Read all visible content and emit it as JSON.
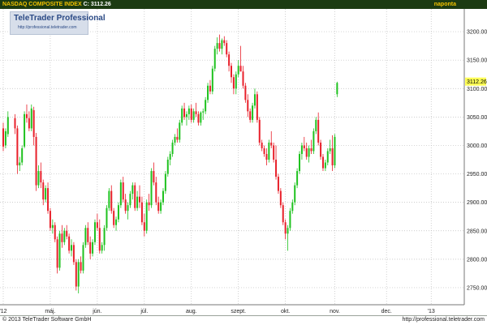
{
  "header": {
    "title": "NASDAQ COMPOSITE INDEX",
    "close_label": "C: 3112.26",
    "period": "naponta"
  },
  "watermark": {
    "title": "TeleTrader Professional",
    "url": "http://professional.teletrader.com"
  },
  "footer": {
    "copyright": "© 2013 TeleTrader Software GmbH",
    "url": "http://professional.teletrader.com"
  },
  "colors": {
    "plot_bg": "#ffffff",
    "grid": "#bdbdbd",
    "up": "#1fc21f",
    "down": "#e8202a",
    "header_bg": "#1c3b12",
    "header_text": "#f2c200",
    "last_price_bg": "#ffff55"
  },
  "chart_data": {
    "type": "candlestick",
    "title": "NASDAQ COMPOSITE INDEX",
    "last_price": "3112.26",
    "ylim": [
      2720,
      3240
    ],
    "y_ticks": [
      "2750.00",
      "2800.00",
      "2850.00",
      "2900.00",
      "2950.00",
      "3000.00",
      "3050.00",
      "3100.00",
      "3150.00",
      "3200.00"
    ],
    "x_ticks": [
      {
        "label": "'12",
        "index": 0
      },
      {
        "label": "máj.",
        "index": 20
      },
      {
        "label": "jún.",
        "index": 40
      },
      {
        "label": "júl.",
        "index": 60
      },
      {
        "label": "aug.",
        "index": 80
      },
      {
        "label": "szept.",
        "index": 100
      },
      {
        "label": "okt.",
        "index": 120
      },
      {
        "label": "nov.",
        "index": 141
      },
      {
        "label": "dec.",
        "index": 163
      },
      {
        "label": "'13",
        "index": 182
      }
    ],
    "grid": "dotted",
    "candles": [
      [
        3030,
        3040,
        2990,
        2998
      ],
      [
        3000,
        3030,
        2995,
        3025
      ],
      [
        3020,
        3060,
        3015,
        3050
      ],
      [
        3048,
        3055,
        3020,
        3030
      ],
      [
        3030,
        3035,
        2950,
        2965
      ],
      [
        2965,
        2980,
        2955,
        2970
      ],
      [
        2970,
        3000,
        2965,
        2995
      ],
      [
        2998,
        3060,
        2995,
        3055
      ],
      [
        3055,
        3072,
        3040,
        3048
      ],
      [
        3048,
        3060,
        3025,
        3030
      ],
      [
        3030,
        3072,
        3025,
        3065
      ],
      [
        3062,
        3068,
        3000,
        3015
      ],
      [
        3015,
        3022,
        2920,
        2930
      ],
      [
        2930,
        2965,
        2925,
        2955
      ],
      [
        2955,
        2970,
        2925,
        2935
      ],
      [
        2935,
        2940,
        2895,
        2905
      ],
      [
        2905,
        2930,
        2900,
        2925
      ],
      [
        2925,
        2935,
        2880,
        2885
      ],
      [
        2885,
        2890,
        2850,
        2855
      ],
      [
        2855,
        2870,
        2845,
        2860
      ],
      [
        2860,
        2865,
        2830,
        2835
      ],
      [
        2835,
        2840,
        2775,
        2785
      ],
      [
        2785,
        2850,
        2780,
        2845
      ],
      [
        2845,
        2860,
        2820,
        2830
      ],
      [
        2830,
        2855,
        2825,
        2850
      ],
      [
        2850,
        2860,
        2835,
        2840
      ],
      [
        2840,
        2845,
        2810,
        2815
      ],
      [
        2815,
        2835,
        2805,
        2825
      ],
      [
        2825,
        2830,
        2790,
        2795
      ],
      [
        2795,
        2800,
        2745,
        2752
      ],
      [
        2752,
        2800,
        2740,
        2795
      ],
      [
        2795,
        2805,
        2775,
        2780
      ],
      [
        2780,
        2830,
        2775,
        2825
      ],
      [
        2825,
        2860,
        2820,
        2855
      ],
      [
        2855,
        2865,
        2825,
        2830
      ],
      [
        2830,
        2840,
        2800,
        2810
      ],
      [
        2810,
        2835,
        2805,
        2830
      ],
      [
        2830,
        2870,
        2825,
        2865
      ],
      [
        2865,
        2880,
        2850,
        2855
      ],
      [
        2855,
        2870,
        2810,
        2815
      ],
      [
        2815,
        2830,
        2810,
        2825
      ],
      [
        2825,
        2860,
        2815,
        2855
      ],
      [
        2855,
        2895,
        2850,
        2890
      ],
      [
        2890,
        2925,
        2885,
        2920
      ],
      [
        2920,
        2930,
        2880,
        2885
      ],
      [
        2885,
        2890,
        2855,
        2860
      ],
      [
        2860,
        2875,
        2850,
        2870
      ],
      [
        2870,
        2900,
        2865,
        2895
      ],
      [
        2895,
        2940,
        2890,
        2935
      ],
      [
        2935,
        2945,
        2900,
        2905
      ],
      [
        2905,
        2915,
        2880,
        2885
      ],
      [
        2885,
        2900,
        2870,
        2895
      ],
      [
        2895,
        2920,
        2890,
        2915
      ],
      [
        2915,
        2935,
        2905,
        2930
      ],
      [
        2930,
        2935,
        2885,
        2890
      ],
      [
        2890,
        2920,
        2885,
        2910
      ],
      [
        2910,
        2930,
        2890,
        2900
      ],
      [
        2900,
        2910,
        2860,
        2865
      ],
      [
        2865,
        2880,
        2840,
        2850
      ],
      [
        2850,
        2905,
        2845,
        2900
      ],
      [
        2900,
        2915,
        2885,
        2895
      ],
      [
        2895,
        2960,
        2890,
        2955
      ],
      [
        2955,
        2970,
        2930,
        2935
      ],
      [
        2935,
        2945,
        2895,
        2900
      ],
      [
        2900,
        2910,
        2880,
        2885
      ],
      [
        2885,
        2905,
        2880,
        2900
      ],
      [
        2900,
        2925,
        2895,
        2920
      ],
      [
        2920,
        2955,
        2915,
        2950
      ],
      [
        2950,
        2980,
        2945,
        2975
      ],
      [
        2975,
        2990,
        2965,
        2985
      ],
      [
        2985,
        3010,
        2980,
        3005
      ],
      [
        3005,
        3020,
        3000,
        3015
      ],
      [
        3015,
        3030,
        3005,
        3010
      ],
      [
        3010,
        3045,
        3005,
        3040
      ],
      [
        3040,
        3070,
        3035,
        3065
      ],
      [
        3065,
        3075,
        3045,
        3050
      ],
      [
        3050,
        3060,
        3035,
        3055
      ],
      [
        3055,
        3070,
        3045,
        3065
      ],
      [
        3065,
        3072,
        3040,
        3045
      ],
      [
        3045,
        3065,
        3040,
        3060
      ],
      [
        3060,
        3075,
        3050,
        3055
      ],
      [
        3055,
        3060,
        3035,
        3040
      ],
      [
        3040,
        3060,
        3035,
        3058
      ],
      [
        3058,
        3065,
        3045,
        3060
      ],
      [
        3060,
        3085,
        3055,
        3080
      ],
      [
        3080,
        3110,
        3075,
        3105
      ],
      [
        3105,
        3115,
        3090,
        3095
      ],
      [
        3095,
        3140,
        3090,
        3135
      ],
      [
        3135,
        3175,
        3130,
        3170
      ],
      [
        3170,
        3190,
        3160,
        3180
      ],
      [
        3180,
        3195,
        3165,
        3170
      ],
      [
        3170,
        3188,
        3160,
        3185
      ],
      [
        3185,
        3192,
        3175,
        3180
      ],
      [
        3180,
        3185,
        3155,
        3160
      ],
      [
        3160,
        3165,
        3130,
        3140
      ],
      [
        3140,
        3145,
        3110,
        3120
      ],
      [
        3120,
        3125,
        3090,
        3100
      ],
      [
        3100,
        3130,
        3090,
        3125
      ],
      [
        3125,
        3150,
        3120,
        3140
      ],
      [
        3140,
        3175,
        3130,
        3130
      ],
      [
        3130,
        3140,
        3100,
        3105
      ],
      [
        3105,
        3110,
        3075,
        3080
      ],
      [
        3080,
        3090,
        3050,
        3060
      ],
      [
        3060,
        3065,
        3040,
        3045
      ],
      [
        3045,
        3075,
        3040,
        3070
      ],
      [
        3070,
        3100,
        3065,
        3090
      ],
      [
        3090,
        3095,
        3040,
        3045
      ],
      [
        3045,
        3050,
        3000,
        3005
      ],
      [
        3005,
        3010,
        2990,
        2995
      ],
      [
        2995,
        3000,
        2980,
        2985
      ],
      [
        2985,
        2995,
        2965,
        2975
      ],
      [
        2975,
        3010,
        2970,
        3005
      ],
      [
        3005,
        3025,
        2995,
        3000
      ],
      [
        3000,
        3005,
        2970,
        2975
      ],
      [
        2975,
        3000,
        2940,
        2945
      ],
      [
        2945,
        2950,
        2915,
        2920
      ],
      [
        2920,
        2925,
        2890,
        2895
      ],
      [
        2895,
        2900,
        2860,
        2865
      ],
      [
        2865,
        2870,
        2835,
        2845
      ],
      [
        2845,
        2860,
        2815,
        2855
      ],
      [
        2855,
        2890,
        2850,
        2885
      ],
      [
        2885,
        2905,
        2880,
        2900
      ],
      [
        2900,
        2935,
        2895,
        2930
      ],
      [
        2930,
        2960,
        2925,
        2955
      ],
      [
        2955,
        2990,
        2950,
        2985
      ],
      [
        2985,
        3005,
        2975,
        3000
      ],
      [
        3000,
        3015,
        2990,
        2995
      ],
      [
        2995,
        3005,
        2975,
        2980
      ],
      [
        2980,
        3000,
        2970,
        2995
      ],
      [
        2995,
        3010,
        2985,
        2990
      ],
      [
        2990,
        3030,
        2985,
        3025
      ],
      [
        3025,
        3050,
        3020,
        3045
      ],
      [
        3045,
        3058,
        3000,
        3005
      ],
      [
        3005,
        3010,
        2975,
        2980
      ],
      [
        2980,
        2985,
        2955,
        2960
      ],
      [
        2960,
        2975,
        2955,
        2970
      ],
      [
        2970,
        2995,
        2965,
        2990
      ],
      [
        2990,
        3010,
        2985,
        2995
      ],
      [
        2995,
        3018,
        2955,
        2965
      ],
      [
        2965,
        3020,
        2960,
        3015
      ],
      [
        3090,
        3112,
        3085,
        3110
      ]
    ],
    "candle_x_index": [
      0,
      1,
      2,
      5,
      6,
      7,
      8,
      9,
      10,
      11,
      12,
      13,
      14,
      15,
      16,
      17,
      18,
      19,
      20,
      21,
      22,
      23,
      24,
      25,
      26,
      27,
      28,
      29,
      30,
      31,
      32,
      33,
      34,
      35,
      36,
      37,
      38,
      39,
      40,
      41,
      42,
      43,
      44,
      45,
      46,
      47,
      48,
      49,
      50,
      51,
      52,
      53,
      54,
      55,
      56,
      57,
      58,
      59,
      60,
      61,
      62,
      63,
      64,
      65,
      66,
      67,
      68,
      69,
      70,
      71,
      72,
      73,
      74,
      75,
      76,
      77,
      78,
      79,
      80,
      81,
      82,
      83,
      84,
      85,
      86,
      87,
      88,
      89,
      90,
      91,
      92,
      93,
      94,
      95,
      96,
      97,
      98,
      99,
      100,
      101,
      102,
      103,
      104,
      105,
      106,
      107,
      108,
      109,
      110,
      111,
      112,
      113,
      114,
      115,
      116,
      117,
      118,
      119,
      120,
      121,
      122,
      123,
      124,
      125,
      126,
      127,
      128,
      129,
      130,
      131,
      132,
      133,
      134,
      135,
      136,
      137,
      138,
      139,
      140,
      141,
      142,
      143,
      144,
      145,
      146,
      147,
      148,
      149,
      150,
      151,
      152,
      153,
      154,
      155,
      156,
      157,
      158,
      159,
      160,
      161,
      162,
      163,
      164,
      165,
      166,
      167,
      168,
      169,
      170,
      171,
      172,
      173,
      174,
      175,
      176,
      177,
      178,
      179,
      180,
      181,
      182,
      183,
      184,
      185,
      186,
      187,
      188,
      189,
      190,
      191,
      192,
      193,
      194
    ]
  }
}
